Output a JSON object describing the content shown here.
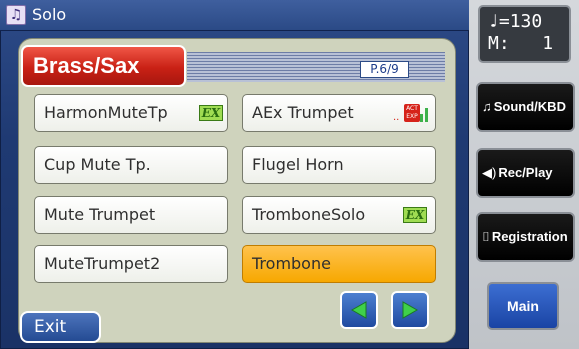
{
  "window": {
    "title": "Solo",
    "icon": "music-note-icon"
  },
  "group": {
    "name": "Brass/Sax",
    "page": "P.6/9",
    "accent": "#d02a1c"
  },
  "tones": [
    {
      "label": "HarmonMuteTp",
      "badge": "EX"
    },
    {
      "label": "AEx Trumpet",
      "badge": "ACT EXP",
      "badge_text": "ACT\nEXP"
    },
    {
      "label": "Cup Mute Tp.",
      "badge": ""
    },
    {
      "label": "Flugel Horn",
      "badge": ""
    },
    {
      "label": "Mute Trumpet",
      "badge": ""
    },
    {
      "label": "TromboneSolo",
      "badge": "EX"
    },
    {
      "label": "MuteTrumpet2",
      "badge": ""
    },
    {
      "label": "Trombone",
      "badge": "",
      "selected": true
    }
  ],
  "navigation": {
    "prev_icon": "left-arrow-icon",
    "next_icon": "right-arrow-icon"
  },
  "exit": {
    "label": "Exit"
  },
  "status": {
    "tempo_symbol": "♩=",
    "tempo": "130",
    "measure_label": "M:",
    "measure": "1"
  },
  "sidebar": {
    "sound_kbd": {
      "label": "Sound/KBD",
      "icon": "music-note-icon"
    },
    "rec_play": {
      "label": "Rec/Play",
      "icon": "speaker-icon"
    },
    "registration": {
      "label": "Registration",
      "icon": "book-icon"
    },
    "main": {
      "label": "Main"
    }
  },
  "colors": {
    "selected": "#f7a800",
    "ex_badge": "#9fdc52",
    "screen": "#1f3a73"
  }
}
